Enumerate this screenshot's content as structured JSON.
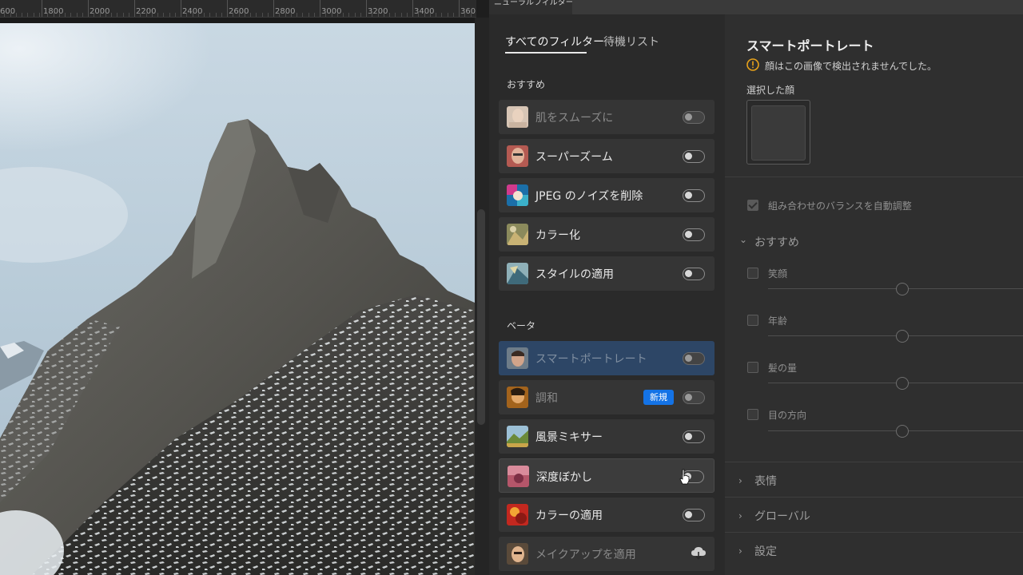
{
  "ruler": {
    "ticks": [
      "600",
      "1800",
      "2000",
      "2200",
      "2400",
      "2600",
      "2800",
      "3000",
      "3200",
      "3400",
      "360"
    ]
  },
  "panel": {
    "tab_title": "ニューラルフィルター"
  },
  "filter_list": {
    "tabs": {
      "all": "すべてのフィルター",
      "waitlist": "待機リスト"
    },
    "recommended": {
      "label": "おすすめ",
      "items": [
        {
          "label": "肌をスムーズに",
          "enabled": false
        },
        {
          "label": "スーパーズーム",
          "enabled": true
        },
        {
          "label": "JPEG のノイズを削除",
          "enabled": true
        },
        {
          "label": "カラー化",
          "enabled": true
        },
        {
          "label": "スタイルの適用",
          "enabled": true
        }
      ]
    },
    "beta": {
      "label": "ベータ",
      "items": [
        {
          "label": "スマートポートレート",
          "enabled": false,
          "selected": true
        },
        {
          "label": "調和",
          "enabled": false,
          "badge": "新規"
        },
        {
          "label": "風景ミキサー",
          "enabled": true
        },
        {
          "label": "深度ぼかし",
          "enabled": true,
          "hovered": true
        },
        {
          "label": "カラーの適用",
          "enabled": true
        },
        {
          "label": "メイクアップを適用",
          "enabled": false,
          "cloud": true
        }
      ]
    }
  },
  "settings": {
    "title": "スマートポートレート",
    "warning": "顔はこの画像で検出されませんでした。",
    "selected_face_label": "選択した顔",
    "auto_balance": {
      "label": "組み合わせのバランスを自動調整",
      "checked": true
    },
    "featured": {
      "label": "おすすめ",
      "sliders": [
        "笑顔",
        "年齢",
        "髪の量",
        "目の方向"
      ]
    },
    "sections": [
      "表情",
      "グローバル",
      "設定"
    ]
  },
  "colors": {
    "selected": "#2d4666",
    "badge": "#1473e6",
    "warning": "#e8a21a"
  }
}
